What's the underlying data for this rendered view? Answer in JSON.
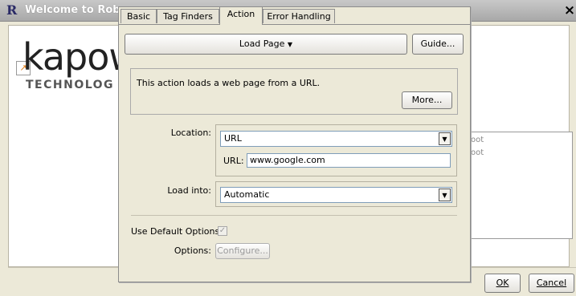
{
  "background_window": {
    "title": "Welcome to Rob",
    "close_symbol": "×",
    "logo_text": "kapow",
    "logo_sub": "TECHNOLOG",
    "list_items": [
      "oot",
      "oot"
    ],
    "ok_label": "OK",
    "cancel_label": "Cancel"
  },
  "tabs": [
    {
      "label": "Basic"
    },
    {
      "label": "Tag Finders"
    },
    {
      "label": "Action",
      "active": true
    },
    {
      "label": "Error Handling"
    }
  ],
  "action": {
    "load_page_label": "Load Page",
    "guide_label": "Guide...",
    "description": "This action loads a web page from a URL.",
    "more_label": "More..."
  },
  "location": {
    "label": "Location:",
    "selected": "URL",
    "url_label": "URL:",
    "url_value": "www.google.com"
  },
  "load_into": {
    "label": "Load into:",
    "selected": "Automatic"
  },
  "options": {
    "default_label": "Use Default Options:",
    "default_checked": true,
    "options_label": "Options:",
    "configure_label": "Configure..."
  },
  "icons": {
    "dropdown": "dropdown-arrow-icon",
    "checkbox": "checkmark-icon",
    "close": "close-icon",
    "app": "robomaker-icon"
  }
}
